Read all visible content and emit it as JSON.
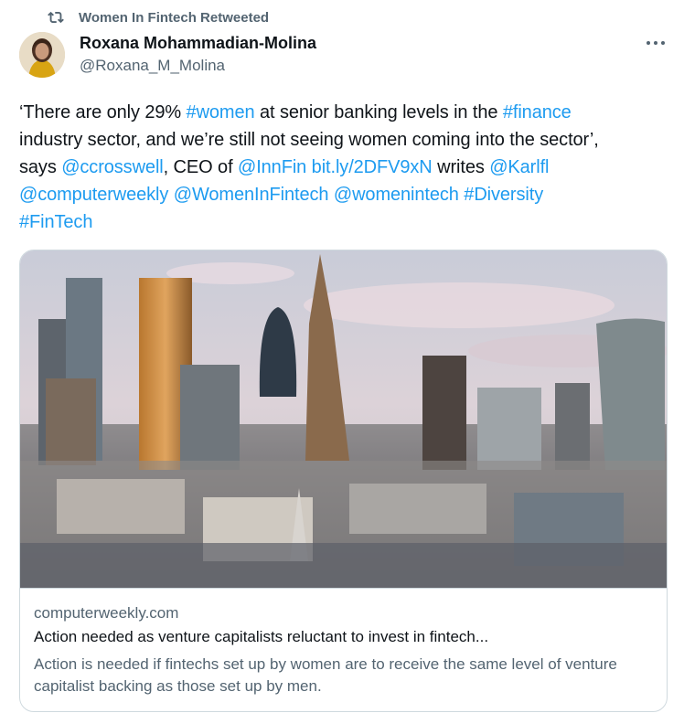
{
  "retweet": {
    "icon": "retweet-icon",
    "label": "Women In Fintech Retweeted"
  },
  "author": {
    "name": "Roxana Mohammadian-Molina",
    "handle": "@Roxana_M_Molina",
    "avatar_icon": "avatar-photo"
  },
  "more_icon": "more-icon",
  "tweet": {
    "l1_t1": "‘There are only 29% ",
    "l1_link1": "#women",
    "l1_t2": " at senior banking levels in the ",
    "l1_link2": "#finance",
    "l2_t1": "industry sector, and we’re still not seeing women coming into the sector’,",
    "l3_t1": "says ",
    "l3_link1": "@ccrosswell",
    "l3_t2": ", CEO of ",
    "l3_link2": "@InnFin",
    "l3_t3": " ",
    "l3_link3": "bit.ly/2DFV9xN",
    "l3_t4": " writes ",
    "l3_link4": "@Karlfl",
    "l4_link1": "@computerweekly",
    "l4_link2": "@WomenInFintech",
    "l4_link3": "@womenintech",
    "l4_link4": "#Diversity",
    "l5_link1": "#FinTech"
  },
  "card": {
    "image_subject": "london-city-skyline-photo",
    "domain": "computerweekly.com",
    "title": "Action needed as venture capitalists reluctant to invest in fintech...",
    "description": "Action is needed if fintechs set up by women are to receive the same level of venture capitalist backing as those set up by men."
  },
  "colors": {
    "link": "#1d9bf0",
    "secondary_text": "#536471",
    "primary_text": "#0f1419",
    "border": "#cfd9de"
  }
}
